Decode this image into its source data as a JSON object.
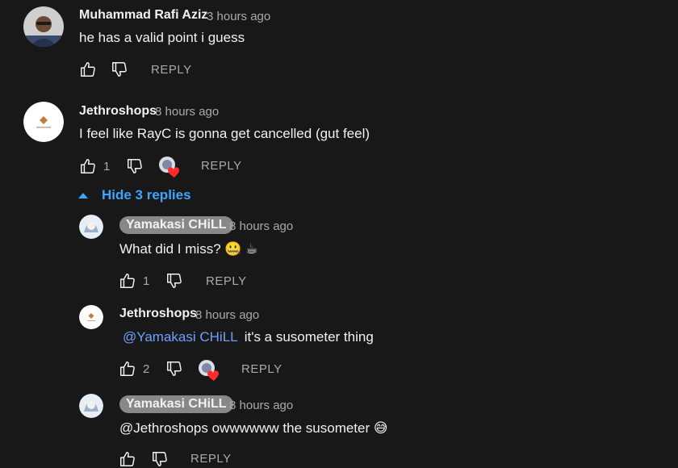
{
  "comments": [
    {
      "author": "Muhammad Rafi Aziz",
      "time": "3 hours ago",
      "text": "he has a valid point i guess",
      "likes": "",
      "reply_label": "REPLY"
    },
    {
      "author": "Jethroshops",
      "time": "8 hours ago",
      "text": "I feel like RayC is gonna get cancelled (gut feel)",
      "likes": "1",
      "reply_label": "REPLY",
      "hide_replies_label": "Hide 3 replies",
      "replies": [
        {
          "author": "Yamakasi CHiLL",
          "time": "8 hours ago",
          "text": "What did I miss? 🤐 ☕",
          "likes": "1",
          "reply_label": "REPLY"
        },
        {
          "author": "Jethroshops",
          "time": "8 hours ago",
          "mention": "@Yamakasi CHiLL",
          "text": "it's a susometer thing",
          "likes": "2",
          "reply_label": "REPLY"
        },
        {
          "author": "Yamakasi CHiLL",
          "time": "8 hours ago",
          "text": "@Jethroshops  owwwwww the susometer 😅",
          "likes": "",
          "reply_label": "REPLY"
        }
      ]
    }
  ],
  "colors": {
    "background": "#181818",
    "text": "#f1f1f1",
    "secondary": "#aaaaaa",
    "link": "#3ea6ff",
    "mention": "#6ea0ff",
    "heart": "#ff2a2a"
  }
}
